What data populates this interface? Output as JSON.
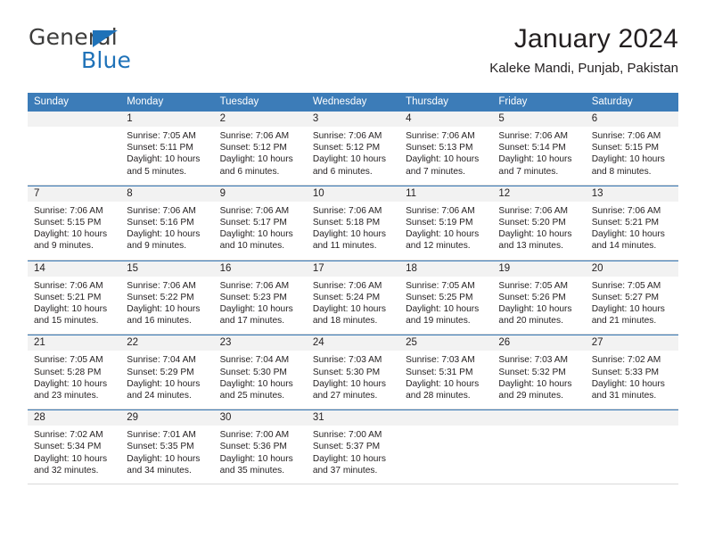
{
  "brand": {
    "name_part1": "General",
    "name_part2": "Blue",
    "triangle_color": "#1f72b8",
    "text_color": "#3c3c3b"
  },
  "header": {
    "title": "January 2024",
    "subtitle": "Kaleke Mandi, Punjab, Pakistan"
  },
  "theme": {
    "header_bg": "#3c7cb8",
    "header_text": "#ffffff",
    "daynum_bg": "#f2f2f2",
    "body_text": "#231f20"
  },
  "calendar": {
    "weekday_headers": [
      "Sunday",
      "Monday",
      "Tuesday",
      "Wednesday",
      "Thursday",
      "Friday",
      "Saturday"
    ],
    "weeks": [
      [
        {
          "day": "",
          "sunrise": "",
          "sunset": "",
          "daylight1": "",
          "daylight2": ""
        },
        {
          "day": "1",
          "sunrise": "Sunrise: 7:05 AM",
          "sunset": "Sunset: 5:11 PM",
          "daylight1": "Daylight: 10 hours",
          "daylight2": "and 5 minutes."
        },
        {
          "day": "2",
          "sunrise": "Sunrise: 7:06 AM",
          "sunset": "Sunset: 5:12 PM",
          "daylight1": "Daylight: 10 hours",
          "daylight2": "and 6 minutes."
        },
        {
          "day": "3",
          "sunrise": "Sunrise: 7:06 AM",
          "sunset": "Sunset: 5:12 PM",
          "daylight1": "Daylight: 10 hours",
          "daylight2": "and 6 minutes."
        },
        {
          "day": "4",
          "sunrise": "Sunrise: 7:06 AM",
          "sunset": "Sunset: 5:13 PM",
          "daylight1": "Daylight: 10 hours",
          "daylight2": "and 7 minutes."
        },
        {
          "day": "5",
          "sunrise": "Sunrise: 7:06 AM",
          "sunset": "Sunset: 5:14 PM",
          "daylight1": "Daylight: 10 hours",
          "daylight2": "and 7 minutes."
        },
        {
          "day": "6",
          "sunrise": "Sunrise: 7:06 AM",
          "sunset": "Sunset: 5:15 PM",
          "daylight1": "Daylight: 10 hours",
          "daylight2": "and 8 minutes."
        }
      ],
      [
        {
          "day": "7",
          "sunrise": "Sunrise: 7:06 AM",
          "sunset": "Sunset: 5:15 PM",
          "daylight1": "Daylight: 10 hours",
          "daylight2": "and 9 minutes."
        },
        {
          "day": "8",
          "sunrise": "Sunrise: 7:06 AM",
          "sunset": "Sunset: 5:16 PM",
          "daylight1": "Daylight: 10 hours",
          "daylight2": "and 9 minutes."
        },
        {
          "day": "9",
          "sunrise": "Sunrise: 7:06 AM",
          "sunset": "Sunset: 5:17 PM",
          "daylight1": "Daylight: 10 hours",
          "daylight2": "and 10 minutes."
        },
        {
          "day": "10",
          "sunrise": "Sunrise: 7:06 AM",
          "sunset": "Sunset: 5:18 PM",
          "daylight1": "Daylight: 10 hours",
          "daylight2": "and 11 minutes."
        },
        {
          "day": "11",
          "sunrise": "Sunrise: 7:06 AM",
          "sunset": "Sunset: 5:19 PM",
          "daylight1": "Daylight: 10 hours",
          "daylight2": "and 12 minutes."
        },
        {
          "day": "12",
          "sunrise": "Sunrise: 7:06 AM",
          "sunset": "Sunset: 5:20 PM",
          "daylight1": "Daylight: 10 hours",
          "daylight2": "and 13 minutes."
        },
        {
          "day": "13",
          "sunrise": "Sunrise: 7:06 AM",
          "sunset": "Sunset: 5:21 PM",
          "daylight1": "Daylight: 10 hours",
          "daylight2": "and 14 minutes."
        }
      ],
      [
        {
          "day": "14",
          "sunrise": "Sunrise: 7:06 AM",
          "sunset": "Sunset: 5:21 PM",
          "daylight1": "Daylight: 10 hours",
          "daylight2": "and 15 minutes."
        },
        {
          "day": "15",
          "sunrise": "Sunrise: 7:06 AM",
          "sunset": "Sunset: 5:22 PM",
          "daylight1": "Daylight: 10 hours",
          "daylight2": "and 16 minutes."
        },
        {
          "day": "16",
          "sunrise": "Sunrise: 7:06 AM",
          "sunset": "Sunset: 5:23 PM",
          "daylight1": "Daylight: 10 hours",
          "daylight2": "and 17 minutes."
        },
        {
          "day": "17",
          "sunrise": "Sunrise: 7:06 AM",
          "sunset": "Sunset: 5:24 PM",
          "daylight1": "Daylight: 10 hours",
          "daylight2": "and 18 minutes."
        },
        {
          "day": "18",
          "sunrise": "Sunrise: 7:05 AM",
          "sunset": "Sunset: 5:25 PM",
          "daylight1": "Daylight: 10 hours",
          "daylight2": "and 19 minutes."
        },
        {
          "day": "19",
          "sunrise": "Sunrise: 7:05 AM",
          "sunset": "Sunset: 5:26 PM",
          "daylight1": "Daylight: 10 hours",
          "daylight2": "and 20 minutes."
        },
        {
          "day": "20",
          "sunrise": "Sunrise: 7:05 AM",
          "sunset": "Sunset: 5:27 PM",
          "daylight1": "Daylight: 10 hours",
          "daylight2": "and 21 minutes."
        }
      ],
      [
        {
          "day": "21",
          "sunrise": "Sunrise: 7:05 AM",
          "sunset": "Sunset: 5:28 PM",
          "daylight1": "Daylight: 10 hours",
          "daylight2": "and 23 minutes."
        },
        {
          "day": "22",
          "sunrise": "Sunrise: 7:04 AM",
          "sunset": "Sunset: 5:29 PM",
          "daylight1": "Daylight: 10 hours",
          "daylight2": "and 24 minutes."
        },
        {
          "day": "23",
          "sunrise": "Sunrise: 7:04 AM",
          "sunset": "Sunset: 5:30 PM",
          "daylight1": "Daylight: 10 hours",
          "daylight2": "and 25 minutes."
        },
        {
          "day": "24",
          "sunrise": "Sunrise: 7:03 AM",
          "sunset": "Sunset: 5:30 PM",
          "daylight1": "Daylight: 10 hours",
          "daylight2": "and 27 minutes."
        },
        {
          "day": "25",
          "sunrise": "Sunrise: 7:03 AM",
          "sunset": "Sunset: 5:31 PM",
          "daylight1": "Daylight: 10 hours",
          "daylight2": "and 28 minutes."
        },
        {
          "day": "26",
          "sunrise": "Sunrise: 7:03 AM",
          "sunset": "Sunset: 5:32 PM",
          "daylight1": "Daylight: 10 hours",
          "daylight2": "and 29 minutes."
        },
        {
          "day": "27",
          "sunrise": "Sunrise: 7:02 AM",
          "sunset": "Sunset: 5:33 PM",
          "daylight1": "Daylight: 10 hours",
          "daylight2": "and 31 minutes."
        }
      ],
      [
        {
          "day": "28",
          "sunrise": "Sunrise: 7:02 AM",
          "sunset": "Sunset: 5:34 PM",
          "daylight1": "Daylight: 10 hours",
          "daylight2": "and 32 minutes."
        },
        {
          "day": "29",
          "sunrise": "Sunrise: 7:01 AM",
          "sunset": "Sunset: 5:35 PM",
          "daylight1": "Daylight: 10 hours",
          "daylight2": "and 34 minutes."
        },
        {
          "day": "30",
          "sunrise": "Sunrise: 7:00 AM",
          "sunset": "Sunset: 5:36 PM",
          "daylight1": "Daylight: 10 hours",
          "daylight2": "and 35 minutes."
        },
        {
          "day": "31",
          "sunrise": "Sunrise: 7:00 AM",
          "sunset": "Sunset: 5:37 PM",
          "daylight1": "Daylight: 10 hours",
          "daylight2": "and 37 minutes."
        },
        {
          "day": "",
          "sunrise": "",
          "sunset": "",
          "daylight1": "",
          "daylight2": ""
        },
        {
          "day": "",
          "sunrise": "",
          "sunset": "",
          "daylight1": "",
          "daylight2": ""
        },
        {
          "day": "",
          "sunrise": "",
          "sunset": "",
          "daylight1": "",
          "daylight2": ""
        }
      ]
    ]
  }
}
